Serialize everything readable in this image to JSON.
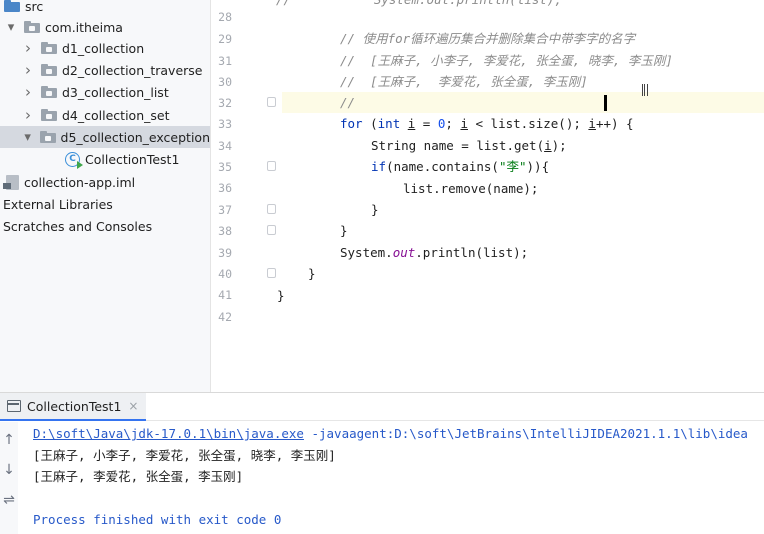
{
  "project_tree": {
    "items": [
      {
        "label": "src",
        "kind": "folder-src",
        "indent": 0,
        "chevron": ""
      },
      {
        "label": "com.itheima",
        "kind": "folder",
        "indent": 1,
        "chevron": "down"
      },
      {
        "label": "d1_collection",
        "kind": "folder",
        "indent": 2,
        "chevron": "right"
      },
      {
        "label": "d2_collection_traverse",
        "kind": "folder",
        "indent": 2,
        "chevron": "right"
      },
      {
        "label": "d3_collection_list",
        "kind": "folder",
        "indent": 2,
        "chevron": "right"
      },
      {
        "label": "d4_collection_set",
        "kind": "folder",
        "indent": 2,
        "chevron": "right"
      },
      {
        "label": "d5_collection_exception",
        "kind": "folder",
        "indent": 2,
        "chevron": "down",
        "selected": true
      },
      {
        "label": "CollectionTest1",
        "kind": "class",
        "indent": 3,
        "chevron": ""
      },
      {
        "label": "collection-app.iml",
        "kind": "iml",
        "indent": 0,
        "chevron": ""
      },
      {
        "label": "External Libraries",
        "kind": "plain",
        "indent": 0,
        "chevron": ""
      },
      {
        "label": "Scratches and Consoles",
        "kind": "plain",
        "indent": 0,
        "chevron": ""
      }
    ]
  },
  "editor": {
    "line_numbers": [
      "28",
      "29",
      "30",
      "31",
      "32",
      "33",
      "34",
      "35",
      "36",
      "37",
      "38",
      "39",
      "40",
      "41",
      "42"
    ],
    "partial_top_line": "//           System.out.println(list);",
    "comment_title": "// 使用for循环遍历集合并删除集合中带李字的名字",
    "comment_before": "//  [王麻子, 小李子, 李爱花, 张全蛋, 晓李, 李玉刚]",
    "comment_after": "//  [王麻子,  李爱花, 张全蛋, 李玉刚]",
    "comment_empty": "//",
    "for_kw": "for",
    "for_int": "int",
    "for_var": "i",
    "for_zero": "0",
    "for_rest_1": " (",
    "for_rest_2": " = ",
    "for_rest_3": "; ",
    "for_rest_4": " < list.size(); ",
    "for_rest_5": "++) {",
    "get_line_a": "String name = list.get(",
    "get_line_b": ");",
    "if_kw": "if",
    "if_a": "(name.contains(",
    "if_str": "\"李\"",
    "if_b": ")){",
    "remove_line": "list.remove(name);",
    "close_brace": "}",
    "println_a": "System.",
    "println_out": "out",
    "println_b": ".println(list);"
  },
  "run_panel": {
    "tab_label": "CollectionTest1",
    "close_glyph": "×",
    "tools": [
      "↑",
      "↓",
      "⇌"
    ],
    "console": {
      "java_path": "D:\\soft\\Java\\jdk-17.0.1\\bin\\java.exe",
      "java_args": " -javaagent:D:\\soft\\JetBrains\\IntelliJIDEA2021.1.1\\lib\\idea",
      "line_before": "[王麻子, 小李子, 李爱花, 张全蛋, 晓李, 李玉刚]",
      "line_after": "[王麻子, 李爱花, 张全蛋, 李玉刚]",
      "finished": "Process finished with exit code 0"
    }
  },
  "colors": {
    "keyword": "#0033b3",
    "comment": "#8c8c8c",
    "string": "#067d17",
    "number": "#1750eb",
    "field": "#871094",
    "link": "#2759c9",
    "selection": "#d5d9e0"
  }
}
